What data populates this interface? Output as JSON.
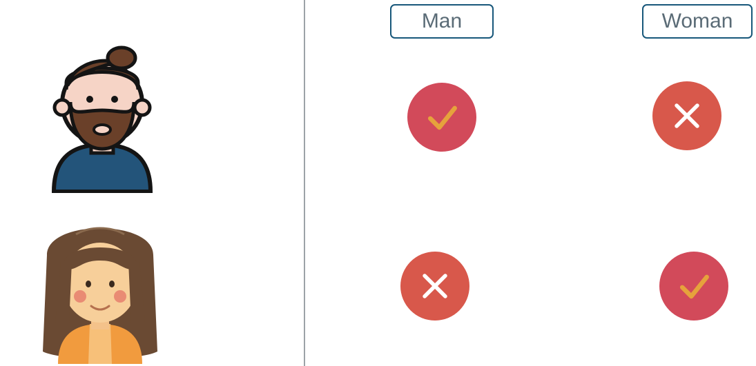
{
  "columns": {
    "man": {
      "label": "Man"
    },
    "woman": {
      "label": "Woman"
    }
  },
  "rows": [
    {
      "subject": "man",
      "avatar_name": "man-avatar-icon",
      "cells": {
        "man": "check",
        "woman": "cross"
      }
    },
    {
      "subject": "woman",
      "avatar_name": "woman-avatar-icon",
      "cells": {
        "man": "cross",
        "woman": "check"
      }
    }
  ],
  "icons": {
    "check": "check-icon",
    "cross": "cross-icon"
  },
  "colors": {
    "check_bg": "#d24a5a",
    "cross_bg": "#d8584b",
    "check_stroke": "#e6a23c",
    "cross_stroke": "#ffffff",
    "header_border": "#17577a",
    "header_text": "#5a6b76"
  }
}
